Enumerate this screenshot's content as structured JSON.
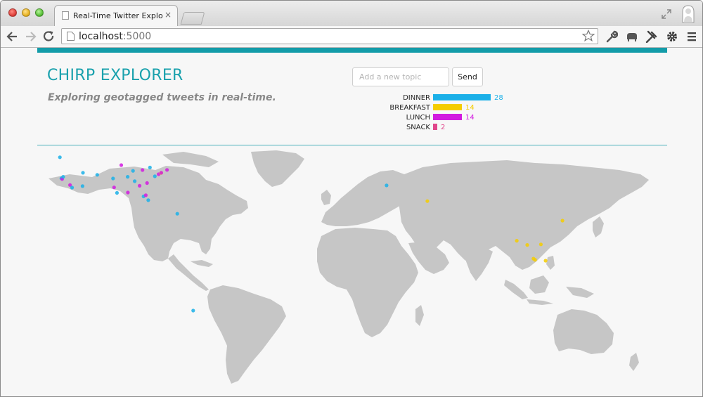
{
  "browser": {
    "tab_title": "Real-Time Twitter Explorer",
    "tab_close": "×",
    "url_host": "localhost",
    "url_port": ":5000"
  },
  "app": {
    "title": "CHIRP EXPLORER",
    "subtitle": "Exploring geotagged tweets in real-time.",
    "input_placeholder": "Add a new topic",
    "send_label": "Send"
  },
  "colors": {
    "accent": "#1aa1ad",
    "dinner": "#1bb0e8",
    "breakfast": "#f4cd00",
    "lunch": "#d21be0",
    "snack": "#e0458a"
  },
  "chart_data": {
    "type": "bar",
    "orientation": "horizontal",
    "categories": [
      "DINNER",
      "BREAKFAST",
      "LUNCH",
      "SNACK"
    ],
    "values": [
      28,
      14,
      14,
      2
    ],
    "colors": [
      "#1bb0e8",
      "#f4cd00",
      "#d21be0",
      "#e0458a"
    ],
    "title": "",
    "xlabel": "",
    "ylabel": ""
  },
  "map_data": {
    "type": "world",
    "points": [
      {
        "lon": -123.1,
        "lat": 49.3,
        "topic": "dinner"
      },
      {
        "lon": -122.4,
        "lat": 37.8,
        "topic": "dinner"
      },
      {
        "lon": -122.0,
        "lat": 37.4,
        "topic": "lunch"
      },
      {
        "lon": -121.5,
        "lat": 38.6,
        "topic": "dinner"
      },
      {
        "lon": -118.2,
        "lat": 34.1,
        "topic": "lunch"
      },
      {
        "lon": -117.2,
        "lat": 32.7,
        "topic": "dinner"
      },
      {
        "lon": -112.1,
        "lat": 33.5,
        "topic": "dinner"
      },
      {
        "lon": -111.9,
        "lat": 40.8,
        "topic": "dinner"
      },
      {
        "lon": -105.0,
        "lat": 39.7,
        "topic": "dinner"
      },
      {
        "lon": -97.3,
        "lat": 37.7,
        "topic": "dinner"
      },
      {
        "lon": -96.8,
        "lat": 32.8,
        "topic": "lunch"
      },
      {
        "lon": -95.4,
        "lat": 29.8,
        "topic": "dinner"
      },
      {
        "lon": -93.3,
        "lat": 45.0,
        "topic": "lunch"
      },
      {
        "lon": -90.2,
        "lat": 38.6,
        "topic": "dinner"
      },
      {
        "lon": -90.1,
        "lat": 30.0,
        "topic": "lunch"
      },
      {
        "lon": -87.6,
        "lat": 41.9,
        "topic": "dinner"
      },
      {
        "lon": -86.8,
        "lat": 36.2,
        "topic": "dinner"
      },
      {
        "lon": -84.4,
        "lat": 33.7,
        "topic": "lunch"
      },
      {
        "lon": -83.0,
        "lat": 42.3,
        "topic": "lunch"
      },
      {
        "lon": -82.5,
        "lat": 27.9,
        "topic": "dinner"
      },
      {
        "lon": -81.4,
        "lat": 28.5,
        "topic": "lunch"
      },
      {
        "lon": -80.2,
        "lat": 25.8,
        "topic": "dinner"
      },
      {
        "lon": -80.8,
        "lat": 35.2,
        "topic": "lunch"
      },
      {
        "lon": -79.4,
        "lat": 43.7,
        "topic": "dinner"
      },
      {
        "lon": -77.0,
        "lat": 38.9,
        "topic": "dinner"
      },
      {
        "lon": -75.2,
        "lat": 40.0,
        "topic": "lunch"
      },
      {
        "lon": -74.0,
        "lat": 40.7,
        "topic": "breakfast"
      },
      {
        "lon": -73.9,
        "lat": 40.8,
        "topic": "lunch"
      },
      {
        "lon": -71.1,
        "lat": 42.4,
        "topic": "lunch"
      },
      {
        "lon": -66.1,
        "lat": 18.4,
        "topic": "dinner"
      },
      {
        "lon": -58.4,
        "lat": -34.6,
        "topic": "dinner"
      },
      {
        "lon": 35.5,
        "lat": 33.9,
        "topic": "dinner"
      },
      {
        "lon": 55.3,
        "lat": 25.3,
        "topic": "breakfast"
      },
      {
        "lon": 120.9,
        "lat": 14.6,
        "topic": "breakfast"
      },
      {
        "lon": 98.7,
        "lat": 3.6,
        "topic": "breakfast"
      },
      {
        "lon": 103.8,
        "lat": 1.3,
        "topic": "breakfast"
      },
      {
        "lon": 106.8,
        "lat": -6.2,
        "topic": "breakfast"
      },
      {
        "lon": 107.6,
        "lat": -6.9,
        "topic": "breakfast"
      },
      {
        "lon": 112.7,
        "lat": -7.3,
        "topic": "breakfast"
      },
      {
        "lon": 110.4,
        "lat": 1.6,
        "topic": "breakfast"
      }
    ]
  }
}
